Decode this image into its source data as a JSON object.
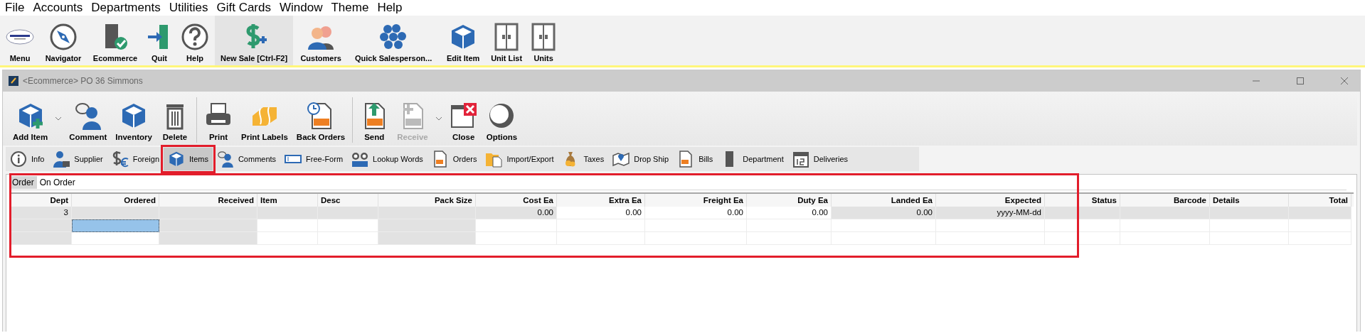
{
  "menu_bar": [
    "File",
    "Accounts",
    "Departments",
    "Utilities",
    "Gift Cards",
    "Window",
    "Theme",
    "Help"
  ],
  "main_toolbar": [
    {
      "label": "Menu",
      "shaded": false
    },
    {
      "label": "Navigator",
      "shaded": false
    },
    {
      "label": "Ecommerce",
      "shaded": false
    },
    {
      "label": "Quit",
      "shaded": false
    },
    {
      "label": "Help",
      "shaded": false
    },
    {
      "label": "New Sale [Ctrl-F2]",
      "shaded": true
    },
    {
      "label": "Customers",
      "shaded": false
    },
    {
      "label": "Quick Salesperson...",
      "shaded": false
    },
    {
      "label": "Edit Item",
      "shaded": false
    },
    {
      "label": "Unit List",
      "shaded": false
    },
    {
      "label": "Units",
      "shaded": false
    }
  ],
  "window": {
    "title": "<Ecommerce> PO 36 Simmons"
  },
  "window_toolbar": [
    [
      {
        "label": "Add Item",
        "disabled": false,
        "dropdown": true
      },
      {
        "label": "Comment",
        "disabled": false,
        "dropdown": false
      },
      {
        "label": "Inventory",
        "disabled": false,
        "dropdown": false
      },
      {
        "label": "Delete",
        "disabled": false,
        "dropdown": false
      }
    ],
    [
      {
        "label": "Print",
        "disabled": false,
        "dropdown": false
      },
      {
        "label": "Print Labels",
        "disabled": false,
        "dropdown": false
      },
      {
        "label": "Back Orders",
        "disabled": false,
        "dropdown": false
      }
    ],
    [
      {
        "label": "Send",
        "disabled": false,
        "dropdown": false
      },
      {
        "label": "Receive",
        "disabled": true,
        "dropdown": true
      },
      {
        "label": "Close",
        "disabled": false,
        "dropdown": false
      },
      {
        "label": "Options",
        "disabled": false,
        "dropdown": false
      }
    ]
  ],
  "tabs": [
    {
      "label": "Info",
      "selected": false,
      "highlighted": false
    },
    {
      "label": "Supplier",
      "selected": false,
      "highlighted": false
    },
    {
      "label": "Foreign",
      "selected": false,
      "highlighted": false
    },
    {
      "label": "Items",
      "selected": true,
      "highlighted": true
    },
    {
      "label": "Comments",
      "selected": false,
      "highlighted": false
    },
    {
      "label": "Free-Form",
      "selected": false,
      "highlighted": false
    },
    {
      "label": "Lookup Words",
      "selected": false,
      "highlighted": false
    },
    {
      "label": "Orders",
      "selected": false,
      "highlighted": false
    },
    {
      "label": "Import/Export",
      "selected": false,
      "highlighted": false
    },
    {
      "label": "Taxes",
      "selected": false,
      "highlighted": false
    },
    {
      "label": "Drop Ship",
      "selected": false,
      "highlighted": false
    },
    {
      "label": "Bills",
      "selected": false,
      "highlighted": false
    },
    {
      "label": "Department",
      "selected": false,
      "highlighted": false
    },
    {
      "label": "Deliveries",
      "selected": false,
      "highlighted": false
    }
  ],
  "sub_tabs": [
    {
      "label": "Order",
      "selected": true
    },
    {
      "label": "On Order",
      "selected": false
    }
  ],
  "table": {
    "highlighted": true,
    "columns": [
      "Dept",
      "Ordered",
      "Received",
      "Item",
      "Desc",
      "Pack Size",
      "Cost Ea",
      "Extra Ea",
      "Freight Ea",
      "Duty Ea",
      "Landed Ea",
      "Expected",
      "Status",
      "Barcode",
      "Details",
      "Total"
    ],
    "rows": [
      [
        {
          "text": "3",
          "shaded": true,
          "selected": false
        },
        {
          "shaded": true,
          "selected": false
        },
        {
          "shaded": true,
          "selected": false
        },
        {
          "shaded": true,
          "selected": false
        },
        {
          "shaded": true,
          "selected": false
        },
        {
          "shaded": true,
          "selected": false
        },
        {
          "text": "0.00",
          "shaded": true,
          "selected": false
        },
        {
          "text": "0.00",
          "shaded": false,
          "selected": false
        },
        {
          "text": "0.00",
          "shaded": false,
          "selected": false
        },
        {
          "text": "0.00",
          "shaded": false,
          "selected": false
        },
        {
          "text": "0.00",
          "shaded": true,
          "selected": false
        },
        {
          "text": "yyyy-MM-dd",
          "shaded": true,
          "selected": false
        },
        {
          "shaded": true,
          "selected": false
        },
        {
          "shaded": true,
          "selected": false
        },
        {
          "shaded": true,
          "selected": false
        },
        {
          "shaded": true,
          "selected": false
        }
      ],
      [
        {
          "shaded": true,
          "selected": false
        },
        {
          "shaded": false,
          "selected": true
        },
        {
          "shaded": true,
          "selected": false
        },
        {
          "shaded": false,
          "selected": false
        },
        {
          "shaded": false,
          "selected": false
        },
        {
          "shaded": true,
          "selected": false
        },
        {
          "shaded": false,
          "selected": false
        },
        {
          "shaded": false,
          "selected": false
        },
        {
          "shaded": false,
          "selected": false
        },
        {
          "shaded": false,
          "selected": false
        },
        {
          "shaded": false,
          "selected": false
        },
        {
          "shaded": false,
          "selected": false
        },
        {
          "shaded": false,
          "selected": false
        },
        {
          "shaded": false,
          "selected": false
        },
        {
          "shaded": false,
          "selected": false
        },
        {
          "shaded": false,
          "selected": false
        }
      ],
      [
        {
          "shaded": true,
          "selected": false
        },
        {
          "shaded": false,
          "selected": false
        },
        {
          "shaded": true,
          "selected": false
        },
        {
          "shaded": false,
          "selected": false
        },
        {
          "shaded": false,
          "selected": false
        },
        {
          "shaded": true,
          "selected": false
        },
        {
          "shaded": false,
          "selected": false
        },
        {
          "shaded": false,
          "selected": false
        },
        {
          "shaded": false,
          "selected": false
        },
        {
          "shaded": false,
          "selected": false
        },
        {
          "shaded": false,
          "selected": false
        },
        {
          "shaded": false,
          "selected": false
        },
        {
          "shaded": false,
          "selected": false
        },
        {
          "shaded": false,
          "selected": false
        },
        {
          "shaded": false,
          "selected": false
        },
        {
          "shaded": false,
          "selected": false
        }
      ]
    ]
  }
}
